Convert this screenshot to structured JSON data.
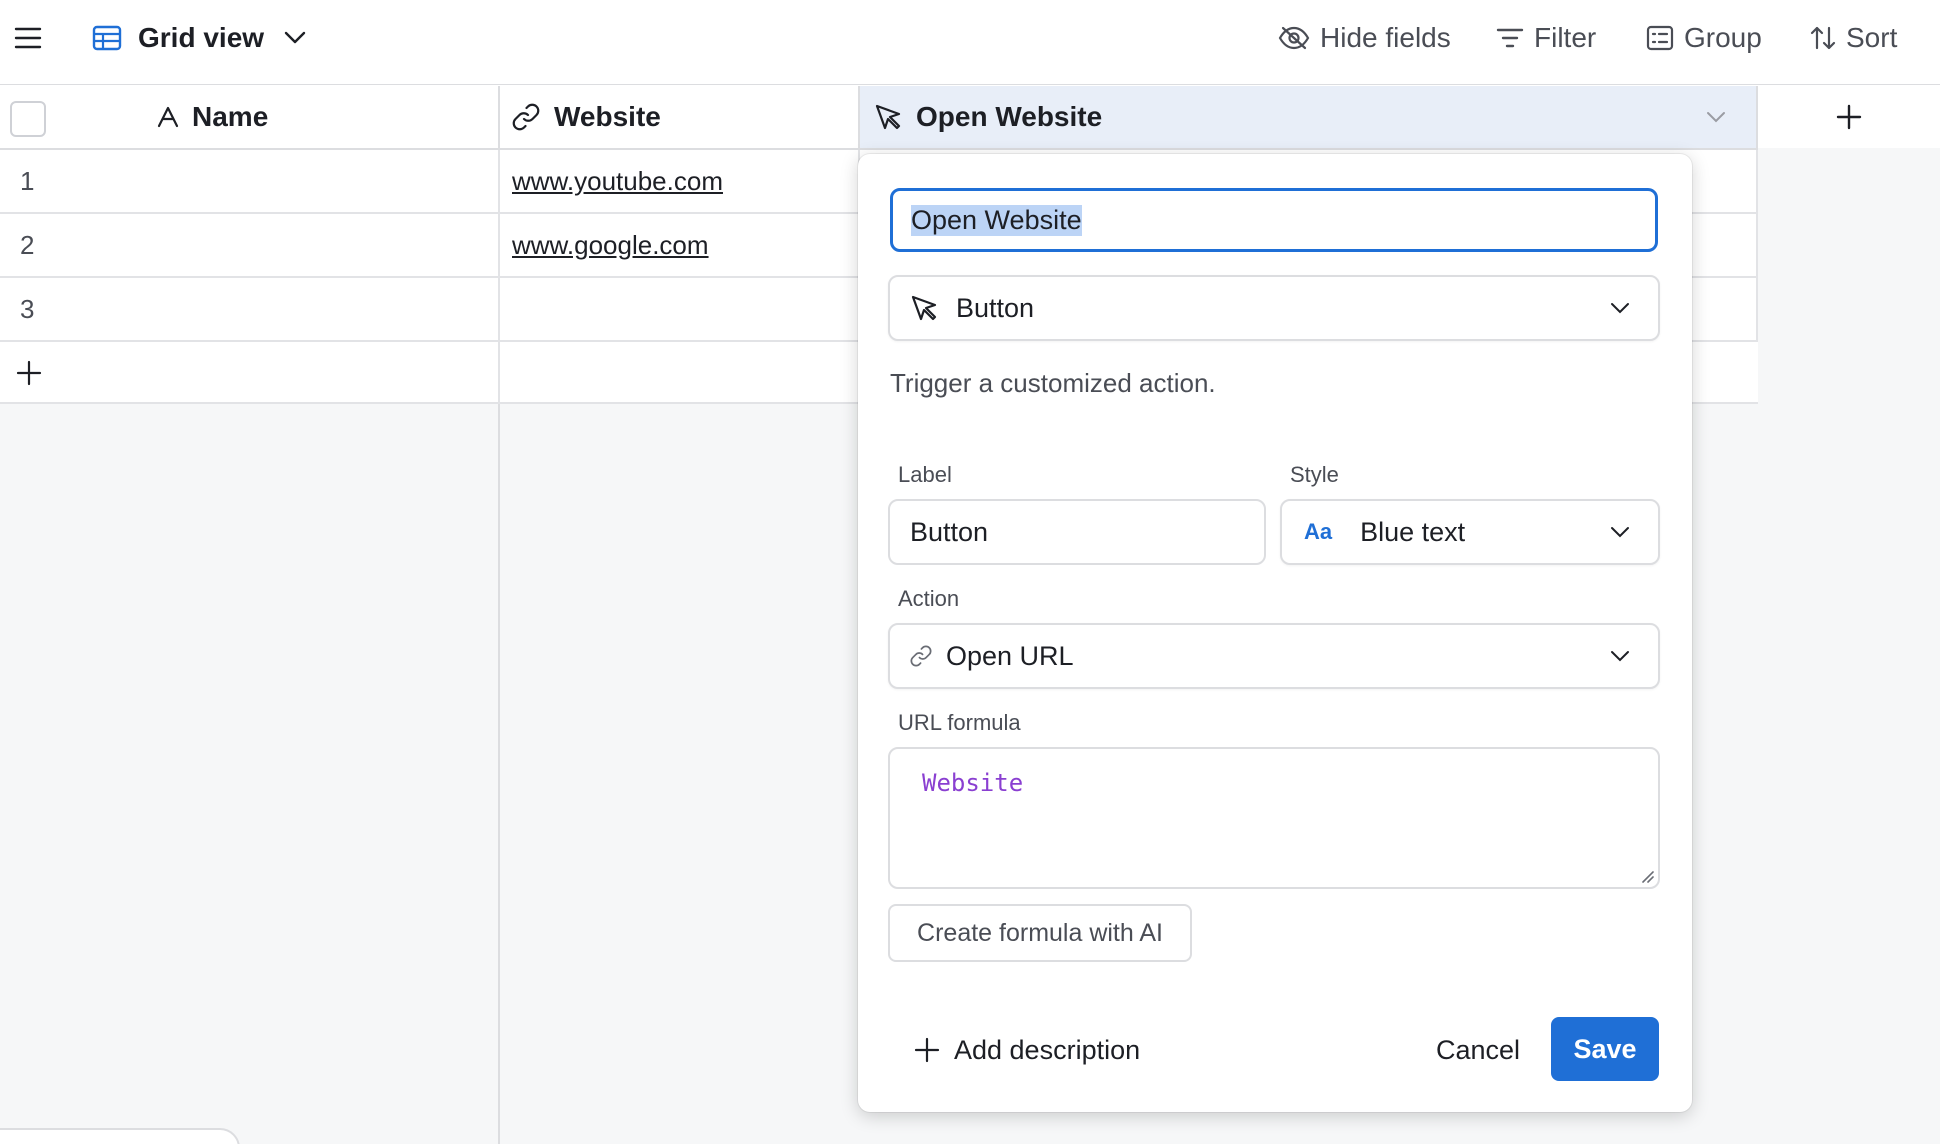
{
  "toolbar": {
    "view_name": "Grid view",
    "hide_fields": "Hide fields",
    "filter": "Filter",
    "group": "Group",
    "sort": "Sort"
  },
  "grid": {
    "columns": [
      "Name",
      "Website",
      "Open Website"
    ],
    "rows": [
      {
        "num": "1",
        "name": "",
        "website": "www.youtube.com"
      },
      {
        "num": "2",
        "name": "",
        "website": "www.google.com"
      },
      {
        "num": "3",
        "name": "",
        "website": ""
      }
    ]
  },
  "popup": {
    "field_name": "Open Website",
    "field_type": "Button",
    "type_description": "Trigger a customized action.",
    "label_label": "Label",
    "label_value": "Button",
    "style_label": "Style",
    "style_icon_text": "Aa",
    "style_value": "Blue text",
    "action_label": "Action",
    "action_value": "Open URL",
    "url_formula_label": "URL formula",
    "url_formula_value": "Website",
    "ai_button": "Create formula with AI",
    "add_description": "Add description",
    "cancel": "Cancel",
    "save": "Save"
  },
  "colors": {
    "accent": "#1f6fd6",
    "formula_token": "#8a3fd1",
    "selection": "#bcd4f6",
    "header_active": "#e8eef8"
  }
}
